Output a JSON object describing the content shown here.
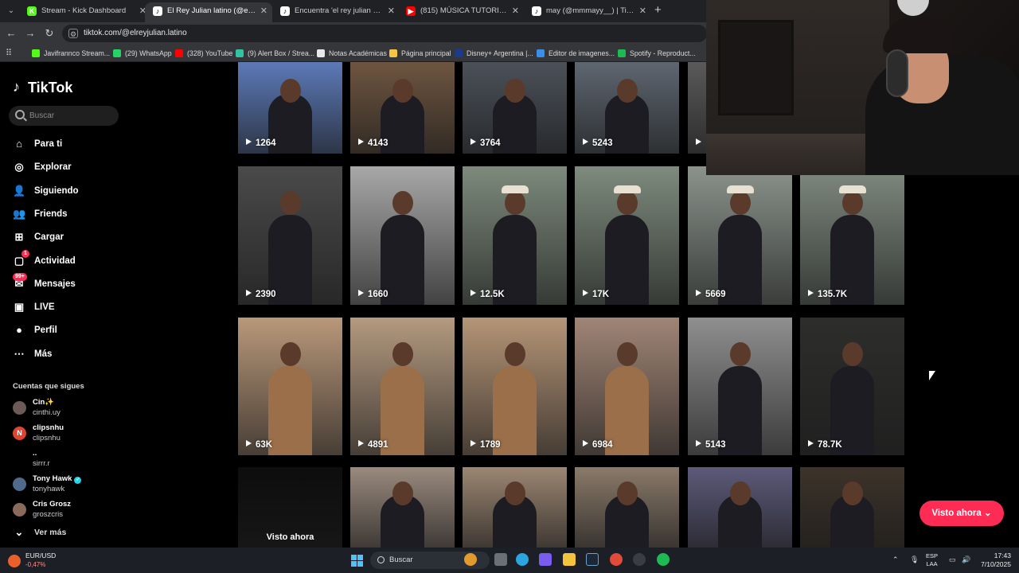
{
  "browser": {
    "tabs": [
      {
        "title": "Stream - Kick Dashboard",
        "icon": "kick-icon",
        "color": "#53fc18",
        "active": false
      },
      {
        "title": "El Rey Julian latino (@elreyjulian",
        "icon": "tiktok-icon",
        "color": "#ffffff",
        "active": true
      },
      {
        "title": "Encuentra 'el rey julian y maxi a",
        "icon": "tiktok-icon",
        "color": "#ffffff",
        "active": false
      },
      {
        "title": "(815) MÚSICA TUTORIAL YUYA",
        "icon": "youtube-icon",
        "color": "#ff0000",
        "active": false
      },
      {
        "title": "may (@mmmayy__) | TikTok",
        "icon": "tiktok-icon",
        "color": "#ffffff",
        "active": false
      }
    ],
    "url": "tiktok.com/@elreyjulian.latino",
    "bookmarks": [
      {
        "label": "Javifrannco Stream...",
        "color": "#53fc18"
      },
      {
        "label": "(29) WhatsApp",
        "color": "#25d366"
      },
      {
        "label": "(328) YouTube",
        "color": "#ff0000"
      },
      {
        "label": "(9) Alert Box / Strea...",
        "color": "#31c3a2"
      },
      {
        "label": "Notas Académicas",
        "color": "#e8e8e8"
      },
      {
        "label": "Página principal",
        "color": "#f4c542"
      },
      {
        "label": "Disney+ Argentina |...",
        "color": "#1a3c8a"
      },
      {
        "label": "Editor de imagenes...",
        "color": "#3b8eea"
      },
      {
        "label": "Spotify - Reproduct...",
        "color": "#1db954"
      }
    ]
  },
  "sidebar": {
    "logo": "TikTok",
    "search_placeholder": "Buscar",
    "nav": [
      {
        "label": "Para ti",
        "icon": "home-icon"
      },
      {
        "label": "Explorar",
        "icon": "compass-icon"
      },
      {
        "label": "Siguiendo",
        "icon": "following-icon"
      },
      {
        "label": "Friends",
        "icon": "friends-icon"
      },
      {
        "label": "Cargar",
        "icon": "upload-icon"
      },
      {
        "label": "Actividad",
        "icon": "activity-icon",
        "badge": "1"
      },
      {
        "label": "Mensajes",
        "icon": "messages-icon",
        "badge": "99+"
      },
      {
        "label": "LIVE",
        "icon": "live-icon"
      },
      {
        "label": "Perfil",
        "icon": "profile-icon"
      },
      {
        "label": "Más",
        "icon": "more-icon"
      }
    ],
    "following_title": "Cuentas que sigues",
    "accounts": [
      {
        "name": "Cin✨",
        "handle": "cinthi.uy",
        "avatar": "",
        "color": "#6b5a55"
      },
      {
        "name": "clipsnhu",
        "handle": "clipsnhu",
        "avatar": "N",
        "color": "#e0442f"
      },
      {
        "name": "..",
        "handle": "sirrr.r",
        "avatar": "",
        "color": "#000000"
      },
      {
        "name": "Tony Hawk",
        "handle": "tonyhawk",
        "avatar": "",
        "color": "#4f6a8a",
        "verified": true
      },
      {
        "name": "Cris Grosz",
        "handle": "groszcris",
        "avatar": "",
        "color": "#8a6a5a"
      }
    ],
    "see_more": "Ver más"
  },
  "grid": {
    "rows": [
      {
        "videos": [
          {
            "views": "1264",
            "bg": "#5c7ab8"
          },
          {
            "views": "4143",
            "bg": "#6e5540"
          },
          {
            "views": "3764",
            "bg": "#4b5159"
          },
          {
            "views": "5243",
            "bg": "#5e6670"
          },
          {
            "views": "",
            "bg": "#5a5a5a"
          }
        ]
      },
      {
        "videos": [
          {
            "views": "2390",
            "bg": "#4a4a4a"
          },
          {
            "views": "1660",
            "bg": "#a8a8a8"
          },
          {
            "views": "12.5K",
            "bg": "#7d8a7c"
          },
          {
            "views": "17K",
            "bg": "#7e8b7d"
          },
          {
            "views": "5669",
            "bg": "#8b938c"
          },
          {
            "views": "135.7K",
            "bg": "#7f8a80"
          }
        ]
      },
      {
        "videos": [
          {
            "views": "63K",
            "bg": "#b9987a"
          },
          {
            "views": "4891",
            "bg": "#b49a80"
          },
          {
            "views": "1789",
            "bg": "#b59577"
          },
          {
            "views": "6984",
            "bg": "#a08576"
          },
          {
            "views": "5143",
            "bg": "#8f8f90"
          },
          {
            "views": "78.7K",
            "bg": "#2d2e2c"
          }
        ]
      },
      {
        "videos": [
          {
            "views": "",
            "watched": "Visto ahora",
            "bg": "#0d0d0d"
          },
          {
            "views": "",
            "bg": "#9a8a7e"
          },
          {
            "views": "",
            "bg": "#9c8672"
          },
          {
            "views": "",
            "bg": "#8a7a6a"
          },
          {
            "views": "",
            "bg": "#5d5a7a"
          },
          {
            "views": "",
            "bg": "#3d332a"
          }
        ]
      }
    ],
    "visto_button": "Visto ahora"
  },
  "taskbar": {
    "ticker_name": "EUR/USD",
    "ticker_change": "-0,47%",
    "search_placeholder": "Buscar",
    "lang_top": "ESP",
    "lang_bottom": "LAA",
    "time": "17:43",
    "date": "7/10/2025"
  },
  "colors": {
    "accent": "#fe2c55",
    "background": "#000000"
  }
}
